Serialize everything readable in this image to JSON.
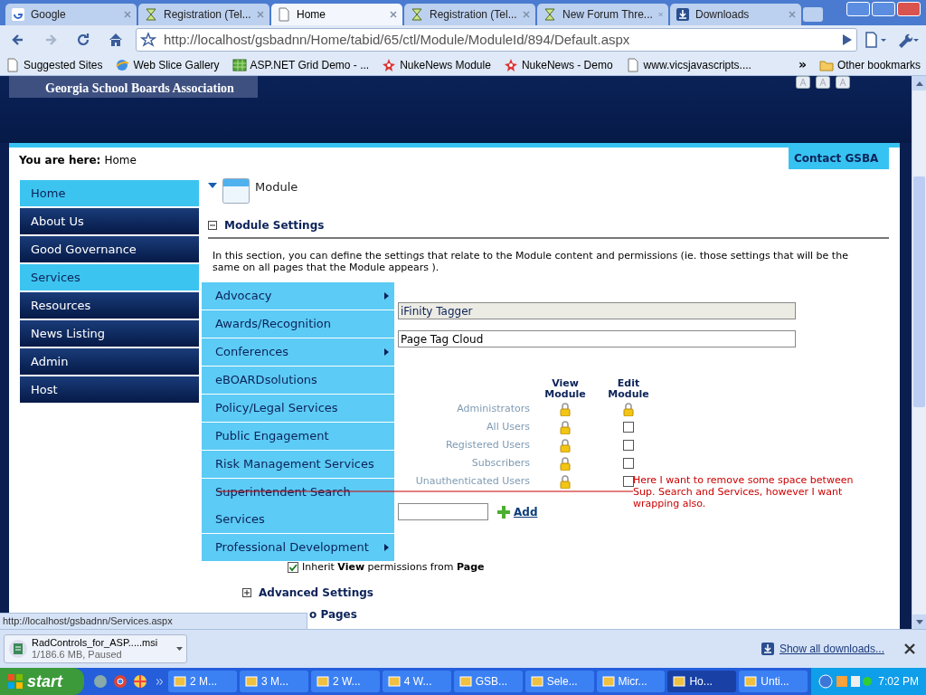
{
  "browser": {
    "tabs": [
      {
        "label": "Google",
        "selected": false
      },
      {
        "label": "Registration (Tel...",
        "selected": false
      },
      {
        "label": "Home",
        "selected": true
      },
      {
        "label": "Registration (Tel...",
        "selected": false
      },
      {
        "label": "New Forum Thre...",
        "selected": false
      },
      {
        "label": "Downloads",
        "selected": false
      }
    ],
    "url": "http://localhost/gsbadnn/Home/tabid/65/ctl/Module/ModuleId/894/Default.aspx",
    "bookmarks": [
      {
        "label": "Suggested Sites"
      },
      {
        "label": "Web Slice Gallery"
      },
      {
        "label": "ASP.NET Grid Demo - ..."
      },
      {
        "label": "NukeNews Module"
      },
      {
        "label": "NukeNews - Demo"
      },
      {
        "label": "www.vicsjavascripts...."
      }
    ],
    "more": "»",
    "other_bookmarks": "Other bookmarks"
  },
  "site": {
    "title": "Georgia School Boards Association",
    "breadcrumb_label": "You are here:",
    "breadcrumb": "Home",
    "contact": "Contact GSBA",
    "nav": [
      {
        "label": "Home",
        "highlighted": true
      },
      {
        "label": "About Us",
        "highlighted": false
      },
      {
        "label": "Good Governance",
        "highlighted": false
      },
      {
        "label": "Services",
        "highlighted": true
      },
      {
        "label": "Resources",
        "highlighted": false
      },
      {
        "label": "News Listing",
        "highlighted": false
      },
      {
        "label": "Admin",
        "highlighted": false
      },
      {
        "label": "Host",
        "highlighted": false
      }
    ],
    "submenu": [
      {
        "label": "Advocacy",
        "has_submenu": true
      },
      {
        "label": "Awards/Recognition",
        "has_submenu": false
      },
      {
        "label": "Conferences",
        "has_submenu": true
      },
      {
        "label": "eBOARDsolutions",
        "has_submenu": false
      },
      {
        "label": "Policy/Legal Services",
        "has_submenu": false
      },
      {
        "label": "Public Engagement",
        "has_submenu": false
      },
      {
        "label": "Risk Management Services",
        "has_submenu": false
      },
      {
        "label": "Superintendent Search Services",
        "has_submenu": false
      },
      {
        "label": "Professional Development",
        "has_submenu": true
      }
    ]
  },
  "module": {
    "header": "Module",
    "settings_title": "Module Settings",
    "expanded": true,
    "description": "In this section, you can define the settings that relate to the Module content and permissions (ie. those settings that will be the same on all pages that the Module appears ).",
    "module_value": "iFinity Tagger",
    "title_value": "Page Tag Cloud",
    "columns": [
      "View Module",
      "Edit Module"
    ],
    "permissions": [
      {
        "role": "Administrators",
        "view": {
          "kind": "lock"
        },
        "edit": {
          "kind": "lock"
        }
      },
      {
        "role": "All Users",
        "view": {
          "kind": "lock"
        },
        "edit": {
          "kind": "checkbox",
          "checked": false
        }
      },
      {
        "role": "Registered Users",
        "view": {
          "kind": "lock"
        },
        "edit": {
          "kind": "checkbox",
          "checked": false
        }
      },
      {
        "role": "Subscribers",
        "view": {
          "kind": "lock"
        },
        "edit": {
          "kind": "checkbox",
          "checked": false
        }
      },
      {
        "role": "Unauthenticated Users",
        "view": {
          "kind": "lock"
        },
        "edit": {
          "kind": "checkbox",
          "checked": false
        }
      }
    ],
    "add": "Add",
    "inherit": {
      "text": "Inherit **View** permissions from **Page**",
      "checked": true
    },
    "advanced": {
      "title": "Advanced Settings",
      "expanded": false
    },
    "pages_fragment": "o Pages"
  },
  "annotation": "Here I want to remove some space between Sup. Search and Services, however I want wrapping also.",
  "status_url": "http://localhost/gsbadnn/Services.aspx",
  "download": {
    "file": "RadControls_for_ASP.....msi",
    "progress": "1/186.6 MB, Paused",
    "show_all": "Show all downloads..."
  },
  "taskbar": {
    "start": "start",
    "tasks": [
      {
        "label": "2 M...",
        "selected": false
      },
      {
        "label": "3 M...",
        "selected": false
      },
      {
        "label": "2 W...",
        "selected": false
      },
      {
        "label": "4 W...",
        "selected": false
      },
      {
        "label": "GSB...",
        "selected": false
      },
      {
        "label": "Sele...",
        "selected": false
      },
      {
        "label": "Micr...",
        "selected": false
      },
      {
        "label": "Ho...",
        "selected": true
      },
      {
        "label": "Unti...",
        "selected": false
      }
    ],
    "clock": "7:02 PM"
  }
}
